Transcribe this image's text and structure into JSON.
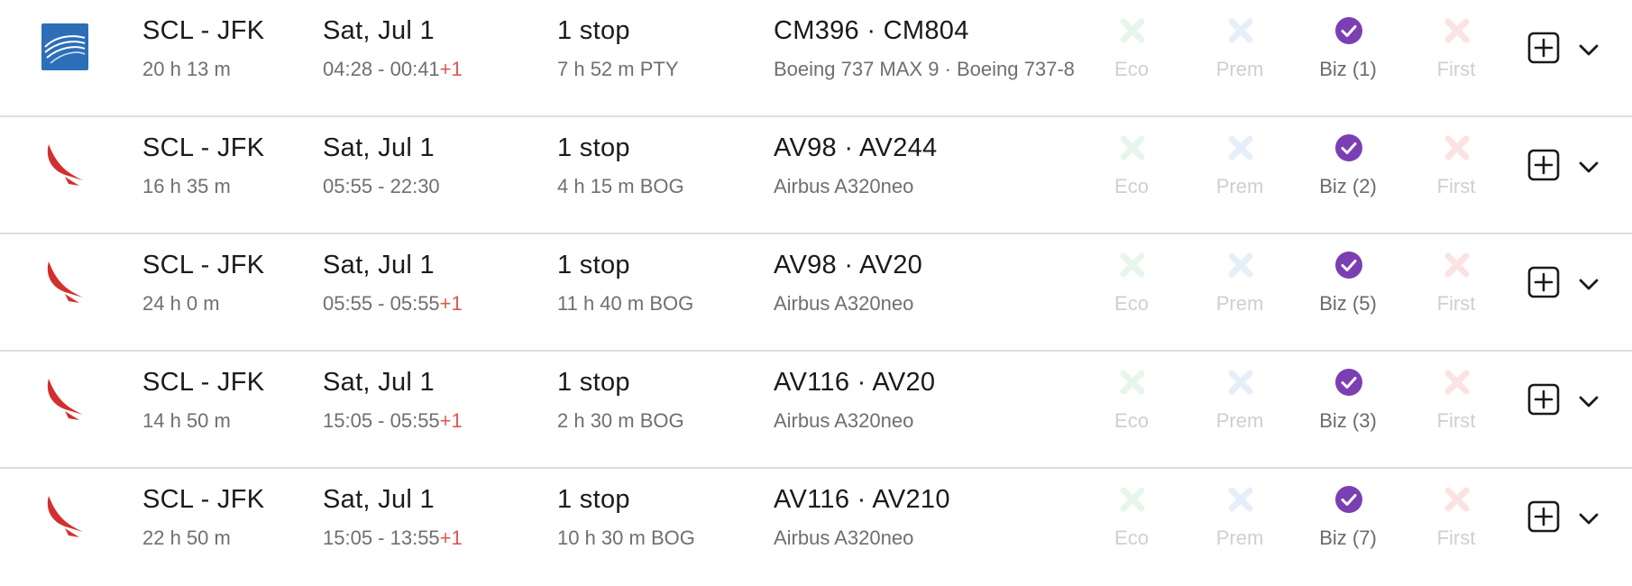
{
  "colors": {
    "eco_mark": "#e6f6ea",
    "prem_mark": "#e4eff9",
    "biz_mark": "#7b3fb3",
    "first_mark": "#fbe3e3",
    "plus_day": "#e2574c",
    "copa_logo": "#2c6fb7",
    "avianca_logo": "#d32f2f"
  },
  "cabin_labels": {
    "eco": "Eco",
    "prem": "Prem",
    "first": "First"
  },
  "flights": [
    {
      "logo": "copa-airlines-logo",
      "route": "SCL - JFK",
      "duration": "20 h 13 m",
      "date": "Sat, Jul 1",
      "times": "04:28 - 00:41",
      "plus_day": "+1",
      "stops": "1 stop",
      "layover": "7 h 52 m  PTY",
      "flight_numbers": "CM396  ·  CM804",
      "aircraft": "Boeing 737 MAX 9  ·  Boeing 737-8",
      "biz": "Biz (1)"
    },
    {
      "logo": "avianca-logo",
      "route": "SCL - JFK",
      "duration": "16 h 35 m",
      "date": "Sat, Jul 1",
      "times": "05:55 - 22:30",
      "plus_day": "",
      "stops": "1 stop",
      "layover": "4 h 15 m  BOG",
      "flight_numbers": "AV98  ·  AV244",
      "aircraft": "Airbus A320neo",
      "biz": "Biz (2)"
    },
    {
      "logo": "avianca-logo",
      "route": "SCL - JFK",
      "duration": "24 h 0 m",
      "date": "Sat, Jul 1",
      "times": "05:55 - 05:55",
      "plus_day": "+1",
      "stops": "1 stop",
      "layover": "11 h 40 m  BOG",
      "flight_numbers": "AV98  ·  AV20",
      "aircraft": "Airbus A320neo",
      "biz": "Biz (5)"
    },
    {
      "logo": "avianca-logo",
      "route": "SCL - JFK",
      "duration": "14 h 50 m",
      "date": "Sat, Jul 1",
      "times": "15:05 - 05:55",
      "plus_day": "+1",
      "stops": "1 stop",
      "layover": "2 h 30 m  BOG",
      "flight_numbers": "AV116  ·  AV20",
      "aircraft": "Airbus A320neo",
      "biz": "Biz (3)"
    },
    {
      "logo": "avianca-logo",
      "route": "SCL - JFK",
      "duration": "22 h 50 m",
      "date": "Sat, Jul 1",
      "times": "15:05 - 13:55",
      "plus_day": "+1",
      "stops": "1 stop",
      "layover": "10 h 30 m  BOG",
      "flight_numbers": "AV116  ·  AV210",
      "aircraft": "Airbus A320neo",
      "biz": "Biz (7)"
    }
  ]
}
